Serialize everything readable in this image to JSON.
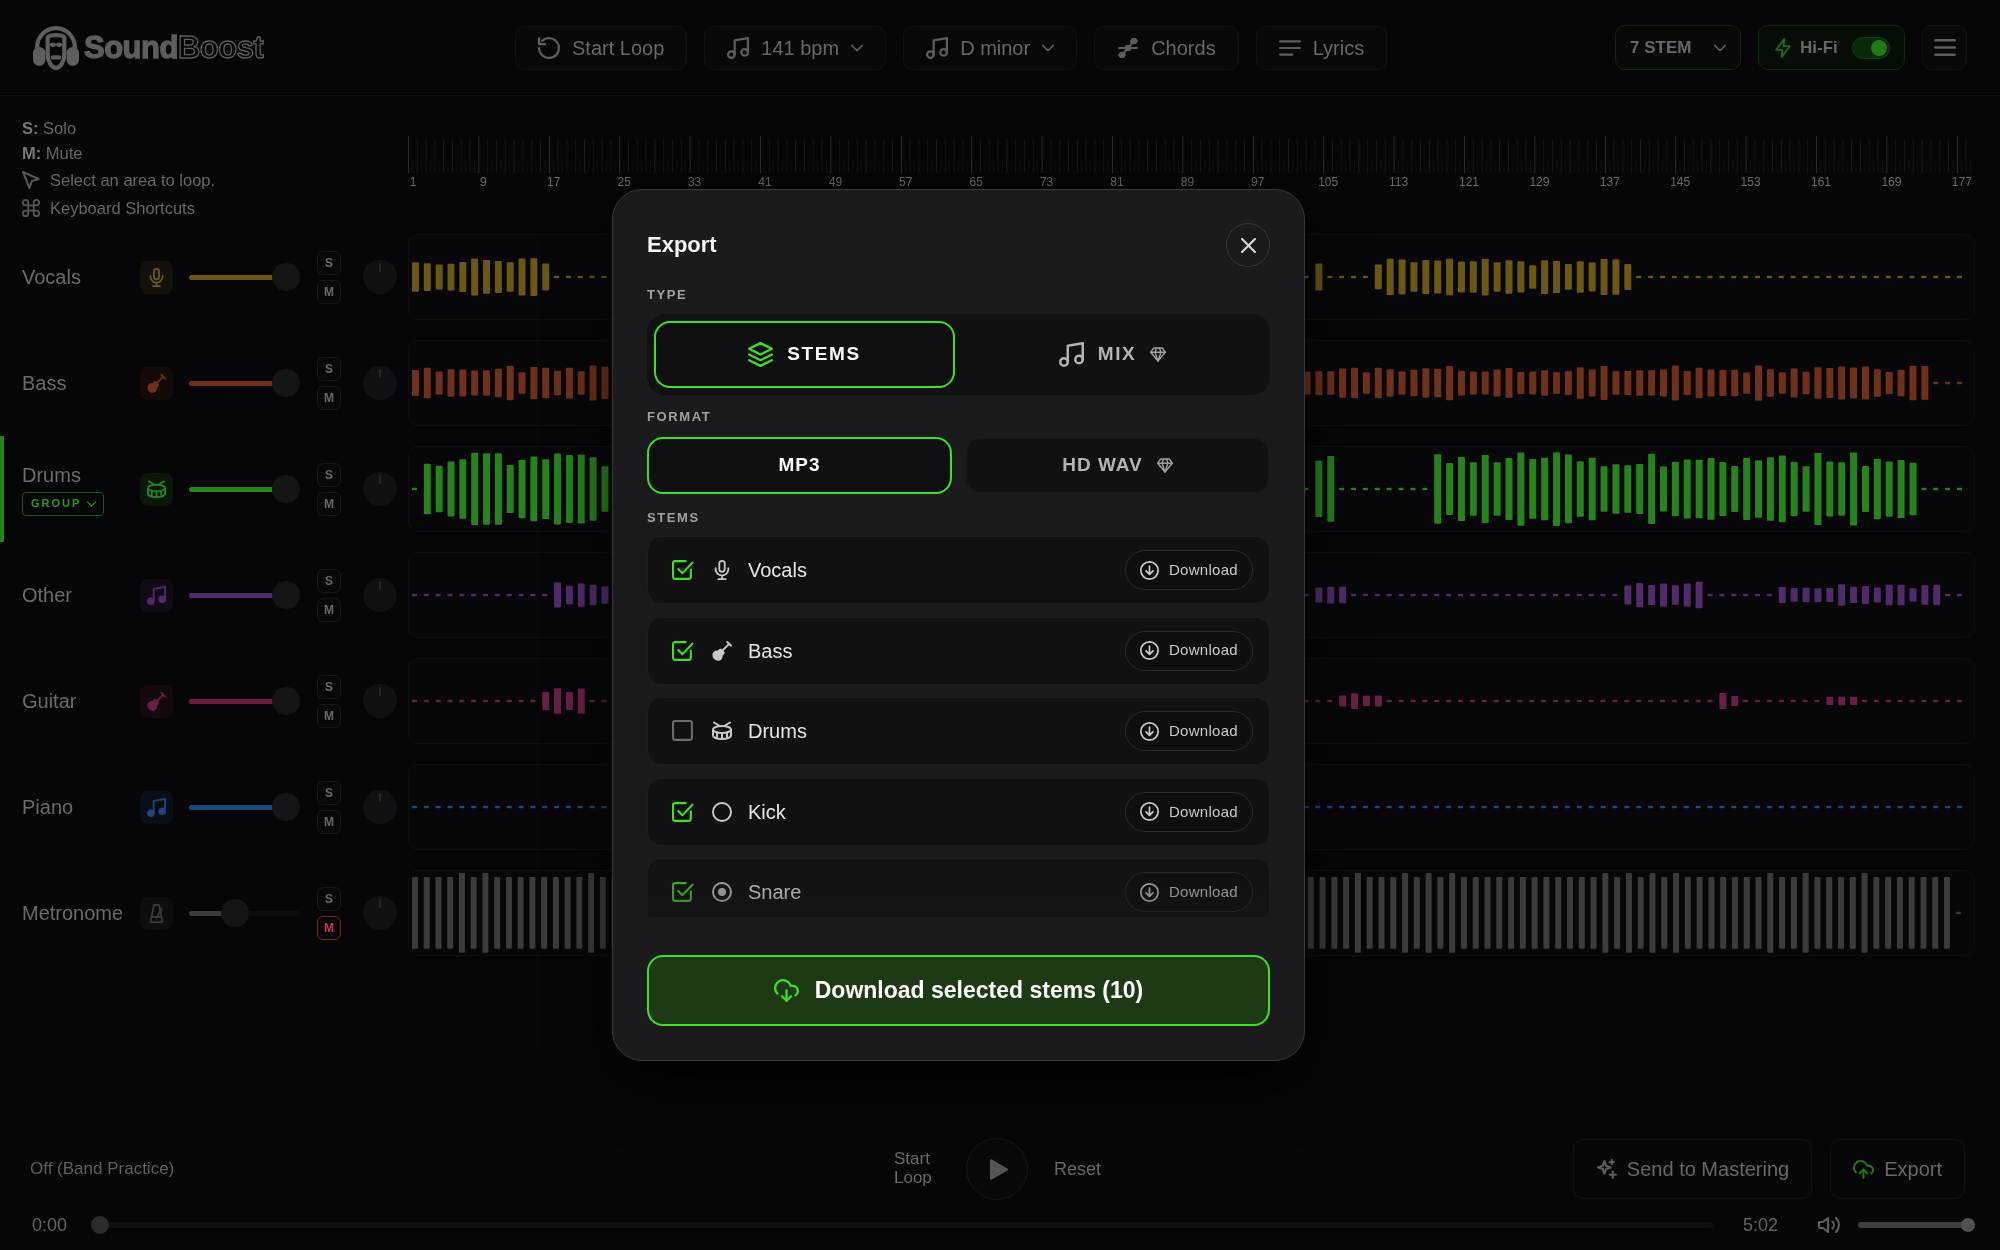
{
  "header": {
    "logo": "**Sound**Boost",
    "toolbar": [
      {
        "kind": "loop",
        "label": "Start Loop",
        "dropdown": false
      },
      {
        "kind": "tempo",
        "label": "141 bpm",
        "dropdown": true
      },
      {
        "kind": "key",
        "label": "D minor",
        "dropdown": true
      },
      {
        "kind": "chords",
        "label": "Chords",
        "dropdown": false
      },
      {
        "kind": "lyrics",
        "label": "Lyrics",
        "dropdown": false
      }
    ],
    "stem_select": {
      "label": "7 STEM"
    },
    "hifi": {
      "label": "Hi-Fi",
      "on": true
    }
  },
  "help": [
    {
      "kind": "legend",
      "text": "**S:** Solo"
    },
    {
      "kind": "legend",
      "text": "**M:** Mute"
    },
    {
      "kind": "cursor",
      "text": "Select an area to loop."
    },
    {
      "kind": "shortcut",
      "text": "Keyboard Shortcuts"
    }
  ],
  "ruler": {
    "labels": [
      "1",
      "9",
      "17",
      "25",
      "33",
      "41",
      "49",
      "57",
      "65",
      "73",
      "81",
      "89",
      "97",
      "105",
      "113",
      "121",
      "129",
      "137",
      "145",
      "153",
      "161",
      "169",
      "177"
    ]
  },
  "tracks": [
    {
      "kind": "vocals",
      "name": "Vocals",
      "color": "#6c5713",
      "level": 1,
      "solo_label": "S",
      "mute_label": "M",
      "solo": false,
      "muted": false,
      "selected": false
    },
    {
      "kind": "bass",
      "name": "Bass",
      "color": "#70301a",
      "level": 1,
      "solo_label": "S",
      "mute_label": "M",
      "solo": false,
      "muted": false,
      "selected": false
    },
    {
      "kind": "drums",
      "name": "Drums",
      "group": "GROUP",
      "color": "#25841a",
      "level": 1,
      "solo_label": "S",
      "mute_label": "M",
      "solo": false,
      "muted": false,
      "selected": true
    },
    {
      "kind": "other",
      "name": "Other",
      "color": "#522b6c",
      "level": 1,
      "solo_label": "S",
      "mute_label": "M",
      "solo": false,
      "muted": false,
      "selected": false
    },
    {
      "kind": "guitar",
      "name": "Guitar",
      "color": "#6b1f46",
      "level": 1,
      "solo_label": "S",
      "mute_label": "M",
      "solo": false,
      "muted": false,
      "selected": false
    },
    {
      "kind": "piano",
      "name": "Piano",
      "color": "#1d477d",
      "level": 1,
      "solo_label": "S",
      "mute_label": "M",
      "solo": false,
      "muted": false,
      "selected": false
    },
    {
      "kind": "metronome",
      "name": "Metronome",
      "color": "#3c3c40",
      "level": 0.38,
      "solo_label": "S",
      "mute_label": "M",
      "solo": false,
      "muted": true,
      "selected": false
    }
  ],
  "transport": {
    "mode": "Off (Band Practice)",
    "loop_label": "Start Loop",
    "reset_label": "Reset",
    "actions": [
      {
        "kind": "mastering",
        "label": "Send to Mastering"
      },
      {
        "kind": "export",
        "label": "Export"
      }
    ],
    "elapsed": "0:00",
    "duration": "5:02",
    "progress": {
      "level": 0
    },
    "volume": {
      "level": 1
    }
  },
  "export_dialog": {
    "title": "Export",
    "type_label": "TYPE",
    "types": [
      {
        "kind": "stems",
        "label": "STEMS",
        "selected": true,
        "premium": false
      },
      {
        "kind": "mix",
        "label": "MIX",
        "selected": false,
        "premium": true
      }
    ],
    "format_label": "FORMAT",
    "formats": [
      {
        "label": "MP3",
        "selected": true,
        "premium": false
      },
      {
        "label": "HD WAV",
        "selected": false,
        "premium": true
      }
    ],
    "stems_label": "STEMS",
    "stems": [
      {
        "kind": "vocals",
        "name": "Vocals",
        "checked": true,
        "action": "Download"
      },
      {
        "kind": "bass",
        "name": "Bass",
        "checked": true,
        "action": "Download"
      },
      {
        "kind": "drums",
        "name": "Drums",
        "checked": false,
        "action": "Download"
      },
      {
        "kind": "kick",
        "name": "Kick",
        "checked": true,
        "action": "Download"
      },
      {
        "kind": "snare",
        "name": "Snare",
        "checked": true,
        "action": "Download"
      }
    ],
    "submit": "Download selected stems (10)"
  }
}
